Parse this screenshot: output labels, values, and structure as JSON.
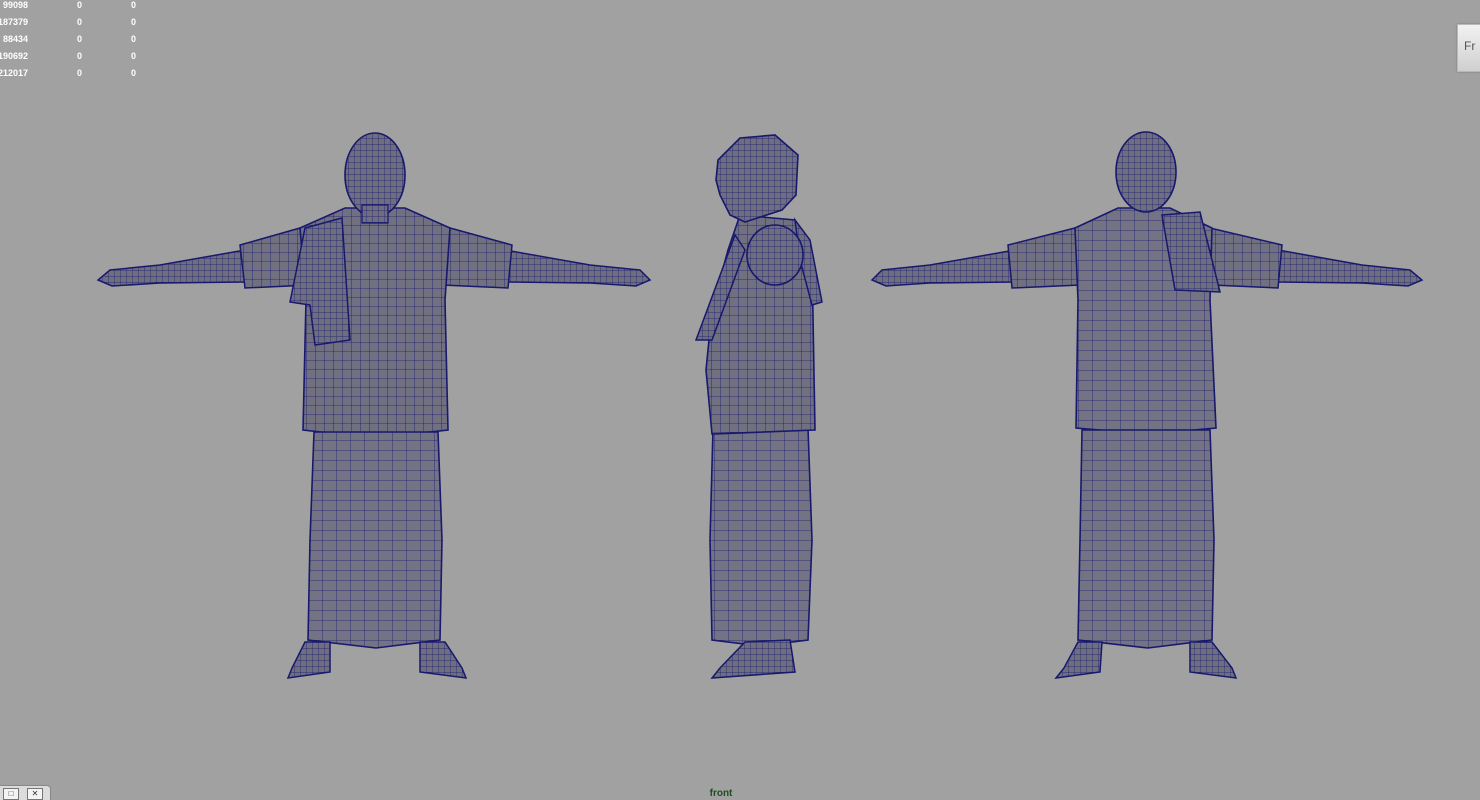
{
  "hud": {
    "rows": [
      [
        "99098",
        "0",
        "0"
      ],
      [
        "187379",
        "0",
        "0"
      ],
      [
        "88434",
        "0",
        "0"
      ],
      [
        "190692",
        "0",
        "0"
      ],
      [
        "212017",
        "0",
        "0"
      ]
    ]
  },
  "view_cube": {
    "label": "Fr",
    "icon": "view-cube-icon"
  },
  "viewport": {
    "camera": "front",
    "background": "#a1a1a1",
    "wire_color": "#18186e",
    "models": [
      "front-view",
      "side-view",
      "back-view"
    ]
  },
  "window_controls": {
    "restore_icon": "restore-icon",
    "close_icon": "close-icon"
  }
}
